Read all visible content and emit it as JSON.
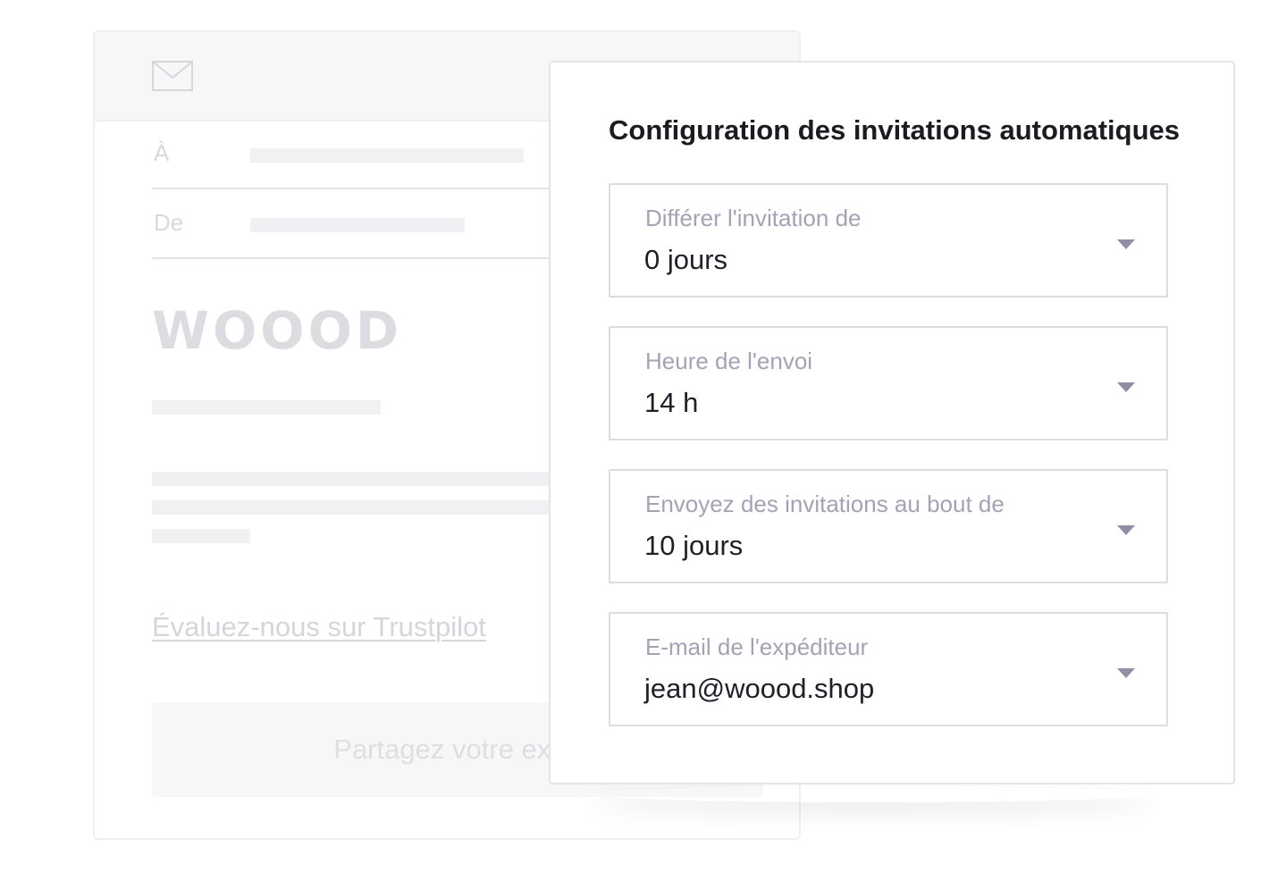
{
  "email_preview": {
    "to_label": "À",
    "from_label": "De",
    "brand_logo": "WOOOD",
    "review_link": "Évaluez-nous sur Trustpilot",
    "share_button": "Partagez votre expé",
    "icon": "envelope-icon"
  },
  "config_panel": {
    "title": "Configuration des invitations automatiques",
    "fields": [
      {
        "label": "Différer l'invitation de",
        "value": "0 jours",
        "icon": "chevron-down-icon"
      },
      {
        "label": "Heure de l'envoi",
        "value": "14 h",
        "icon": "chevron-down-icon"
      },
      {
        "label": "Envoyez des invitations au bout de",
        "value": "10 jours",
        "icon": "chevron-down-icon"
      },
      {
        "label": "E-mail de l'expéditeur",
        "value": "jean@woood.shop",
        "icon": "chevron-down-icon"
      }
    ]
  },
  "colors": {
    "title_text": "#1b1b21",
    "field_label": "#a3a3b6",
    "field_value": "#202029",
    "border": "#dcdce3",
    "faded_preview": "#d8d8de"
  }
}
